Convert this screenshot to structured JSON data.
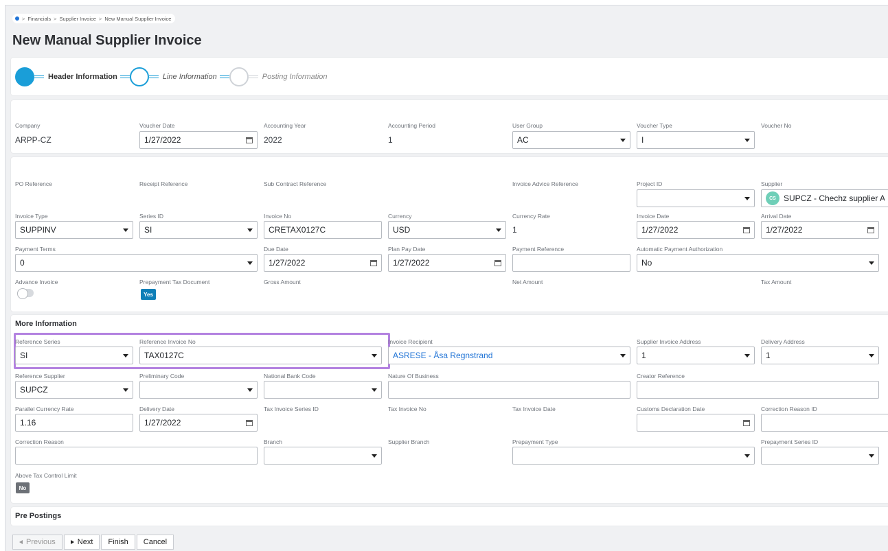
{
  "breadcrumb": {
    "items": [
      "Financials",
      "Supplier Invoice",
      "New Manual Supplier Invoice"
    ]
  },
  "page": {
    "title": "New Manual Supplier Invoice"
  },
  "wizard": {
    "steps": [
      "Header Information",
      "Line Information",
      "Posting Information"
    ]
  },
  "header": {
    "company": {
      "label": "Company",
      "value": "ARPP-CZ"
    },
    "voucher_date": {
      "label": "Voucher Date",
      "value": "1/27/2022"
    },
    "accounting_year": {
      "label": "Accounting Year",
      "value": "2022"
    },
    "accounting_period": {
      "label": "Accounting Period",
      "value": "1"
    },
    "user_group": {
      "label": "User Group",
      "value": "AC"
    },
    "voucher_type": {
      "label": "Voucher Type",
      "value": "I"
    },
    "voucher_no": {
      "label": "Voucher No",
      "value": ""
    }
  },
  "invoice": {
    "po_reference": {
      "label": "PO Reference"
    },
    "receipt_reference": {
      "label": "Receipt Reference"
    },
    "sub_contract_reference": {
      "label": "Sub Contract Reference"
    },
    "invoice_advice_reference": {
      "label": "Invoice Advice Reference"
    },
    "project_id": {
      "label": "Project ID",
      "value": ""
    },
    "supplier": {
      "label": "Supplier",
      "initials": "CS",
      "value": "SUPCZ - Chechz supplier AR"
    },
    "invoice_type": {
      "label": "Invoice Type",
      "value": "SUPPINV"
    },
    "series_id": {
      "label": "Series ID",
      "value": "SI"
    },
    "invoice_no": {
      "label": "Invoice No",
      "value": "CRETAX0127C"
    },
    "currency": {
      "label": "Currency",
      "value": "USD"
    },
    "currency_rate": {
      "label": "Currency Rate",
      "value": "1"
    },
    "invoice_date": {
      "label": "Invoice Date",
      "value": "1/27/2022"
    },
    "arrival_date": {
      "label": "Arrival Date",
      "value": "1/27/2022"
    },
    "payment_terms": {
      "label": "Payment Terms",
      "value": "0"
    },
    "due_date": {
      "label": "Due Date",
      "value": "1/27/2022"
    },
    "plan_pay_date": {
      "label": "Plan Pay Date",
      "value": "1/27/2022"
    },
    "payment_reference": {
      "label": "Payment Reference",
      "value": ""
    },
    "automatic_payment_authorization": {
      "label": "Automatic Payment Authorization",
      "value": "No"
    },
    "advance_invoice": {
      "label": "Advance Invoice",
      "on": false
    },
    "prepayment_tax_document": {
      "label": "Prepayment Tax Document",
      "value": "Yes"
    },
    "gross_amount": {
      "label": "Gross Amount"
    },
    "net_amount": {
      "label": "Net Amount"
    },
    "tax_amount": {
      "label": "Tax Amount"
    }
  },
  "more_info": {
    "title": "More Information",
    "reference_series": {
      "label": "Reference Series",
      "value": "SI"
    },
    "reference_invoice_no": {
      "label": "Reference Invoice No",
      "value": "TAX0127C"
    },
    "invoice_recipient": {
      "label": "Invoice Recipient",
      "value": "ASRESE - Åsa Regnstrand"
    },
    "supplier_invoice_address": {
      "label": "Supplier Invoice Address",
      "value": "1"
    },
    "delivery_address": {
      "label": "Delivery Address",
      "value": "1"
    },
    "reference_supplier": {
      "label": "Reference Supplier",
      "value": "SUPCZ"
    },
    "preliminary_code": {
      "label": "Preliminary Code",
      "value": ""
    },
    "national_bank_code": {
      "label": "National Bank Code",
      "value": ""
    },
    "nature_of_business": {
      "label": "Nature Of Business",
      "value": ""
    },
    "creator_reference": {
      "label": "Creator Reference",
      "value": ""
    },
    "parallel_currency_rate": {
      "label": "Parallel Currency Rate",
      "value": "1.16"
    },
    "delivery_date": {
      "label": "Delivery Date",
      "value": "1/27/2022"
    },
    "tax_invoice_series_id": {
      "label": "Tax Invoice Series ID"
    },
    "tax_invoice_no": {
      "label": "Tax Invoice No"
    },
    "tax_invoice_date": {
      "label": "Tax Invoice Date"
    },
    "customs_declaration_date": {
      "label": "Customs Declaration Date",
      "value": ""
    },
    "correction_reason_id": {
      "label": "Correction Reason ID",
      "value": ""
    },
    "correction_reason": {
      "label": "Correction Reason",
      "value": ""
    },
    "branch": {
      "label": "Branch",
      "value": ""
    },
    "supplier_branch": {
      "label": "Supplier Branch"
    },
    "prepayment_type": {
      "label": "Prepayment Type",
      "value": ""
    },
    "prepayment_series_id": {
      "label": "Prepayment Series ID",
      "value": ""
    },
    "above_tax_control_limit": {
      "label": "Above Tax Control Limit",
      "value": "No"
    }
  },
  "pre_postings": {
    "title": "Pre Postings"
  },
  "footer": {
    "previous": "Previous",
    "next": "Next",
    "finish": "Finish",
    "cancel": "Cancel"
  },
  "colors": {
    "accent": "#1a9ed8",
    "highlight": "#b382e0",
    "link": "#1f73d6"
  }
}
